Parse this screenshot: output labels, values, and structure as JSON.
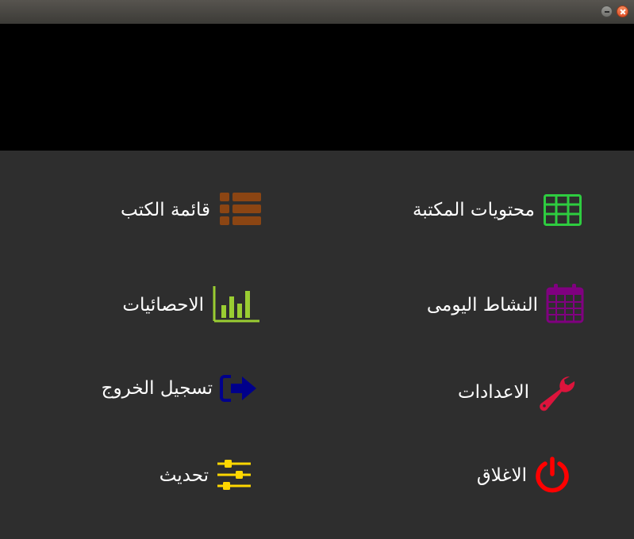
{
  "window": {
    "buttons": [
      "minimize",
      "close"
    ]
  },
  "menu": {
    "items": [
      {
        "id": "library-contents",
        "label": "محتويات المكتبة",
        "icon": "grid-table-icon",
        "color": "#2ecc40"
      },
      {
        "id": "book-list",
        "label": "قائمة الكتب",
        "icon": "list-icon",
        "color": "#8b4513"
      },
      {
        "id": "daily-activity",
        "label": "النشاط اليومى",
        "icon": "calendar-icon",
        "color": "#800080"
      },
      {
        "id": "statistics",
        "label": "الاحصائيات",
        "icon": "bar-chart-icon",
        "color": "#9acd32"
      },
      {
        "id": "settings",
        "label": "الاعدادات",
        "icon": "wrench-icon",
        "color": "#dc143c"
      },
      {
        "id": "logout",
        "label": "تسجيل الخروج",
        "icon": "sign-out-icon",
        "color": "#00008b"
      },
      {
        "id": "close",
        "label": "الاغلاق",
        "icon": "power-icon",
        "color": "#ff0000"
      },
      {
        "id": "refresh",
        "label": "تحديث",
        "icon": "sliders-icon",
        "color": "#ffd700"
      }
    ]
  }
}
